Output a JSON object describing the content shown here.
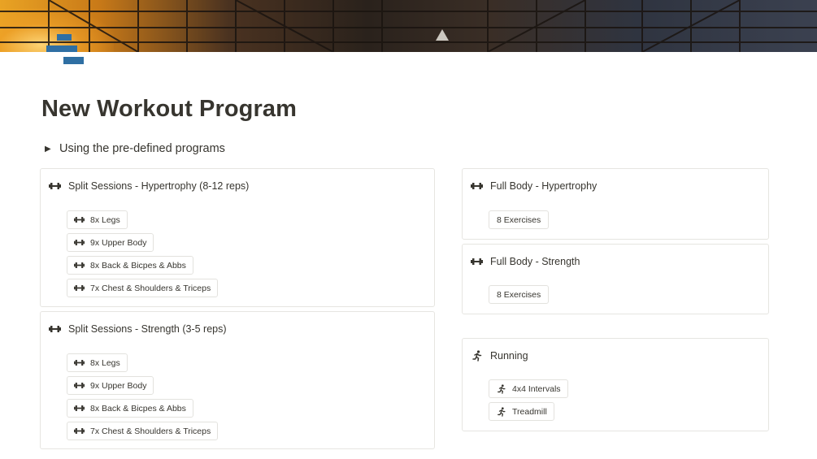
{
  "page": {
    "title": "New Workout Program"
  },
  "toggle": {
    "label": "Using the pre-defined programs"
  },
  "cards": {
    "split_hypertrophy": {
      "title": "Split Sessions - Hypertrophy (8-12 reps)",
      "icon": "dumbbell-icon",
      "items": [
        "8x Legs",
        "9x Upper Body",
        "8x Back & Bicpes & Abbs",
        "7x Chest & Shoulders & Triceps"
      ]
    },
    "split_strength": {
      "title": "Split Sessions - Strength (3-5 reps)",
      "icon": "dumbbell-icon",
      "items": [
        "8x Legs",
        "9x Upper Body",
        "8x Back & Bicpes & Abbs",
        "7x Chest & Shoulders & Triceps"
      ]
    },
    "full_hypertrophy": {
      "title": "Full Body - Hypertrophy",
      "icon": "dumbbell-icon",
      "items": [
        "8 Exercises"
      ]
    },
    "full_strength": {
      "title": "Full Body - Strength",
      "icon": "dumbbell-icon",
      "items": [
        "8 Exercises"
      ]
    },
    "running": {
      "title": "Running",
      "icon": "runner-icon",
      "items": [
        "4x4 Intervals",
        "Treadmill"
      ]
    }
  },
  "colors": {
    "text": "#37352f",
    "border": "#e6e5e1",
    "icon_blue": "#2f6fa3"
  }
}
